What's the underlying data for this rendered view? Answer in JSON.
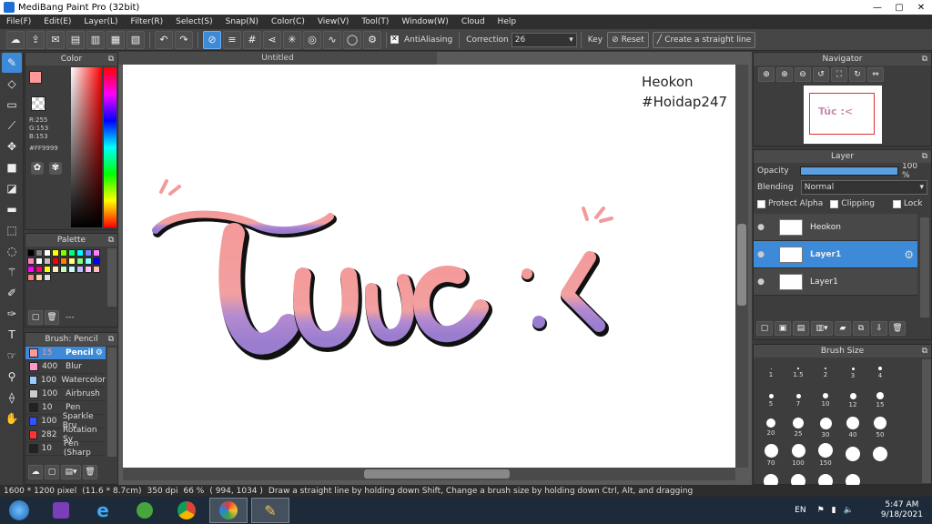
{
  "window": {
    "title": "MediBang Paint Pro (32bit)",
    "controls": [
      "—",
      "▢",
      "✕"
    ]
  },
  "menu": [
    "File(F)",
    "Edit(E)",
    "Layer(L)",
    "Filter(R)",
    "Select(S)",
    "Snap(N)",
    "Color(C)",
    "View(V)",
    "Tool(T)",
    "Window(W)",
    "Cloud",
    "Help"
  ],
  "toolbar": {
    "antialiasing_label": "AntiAliasing",
    "correction_label": "Correction",
    "correction_value": "26",
    "key_label": "Key",
    "reset_label": "Reset",
    "straight_line_label": "Create a straight line"
  },
  "color_panel": {
    "title": "Color",
    "r": "R:255",
    "g": "G:153",
    "b": "B:153",
    "hex": "#FF9999",
    "fg_color": "#ff9999",
    "bg_color": "#ff6600"
  },
  "palette_panel": {
    "title": "Palette",
    "menu_label": "---",
    "colors": [
      "#000000",
      "#808080",
      "#ffffff",
      "#ffff00",
      "#80ff00",
      "#00ff80",
      "#00ffff",
      "#8080ff",
      "#ff80ff",
      "#ff80c0",
      "#ffffff",
      "#c0c0c0",
      "#ff0000",
      "#ff8000",
      "#ffff80",
      "#80ff80",
      "#80ffff",
      "#0000ff",
      "#ff00ff",
      "#ff0080",
      "#ffff00",
      "#fff0c0",
      "#c0ffc0",
      "#c0ffff",
      "#c0c0ff",
      "#ffc0ff",
      "#ffc0c0",
      "#ff8080",
      "#ffd0a0",
      "#e0e0e0"
    ]
  },
  "brush_panel": {
    "title": "Brush: Pencil",
    "brushes": [
      {
        "size": "15",
        "name": "Pencil",
        "color": "#ff9999"
      },
      {
        "size": "400",
        "name": "Blur",
        "color": "#ff99cc"
      },
      {
        "size": "100",
        "name": "Watercolor",
        "color": "#99ccff"
      },
      {
        "size": "100",
        "name": "Airbrush",
        "color": "#cccccc"
      },
      {
        "size": "10",
        "name": "Pen",
        "color": "#222222"
      },
      {
        "size": "100",
        "name": "Sparkle Bru",
        "color": "#3355ff"
      },
      {
        "size": "282",
        "name": "Rotation Sy",
        "color": "#ff3333"
      },
      {
        "size": "10",
        "name": "Pen (Sharp",
        "color": "#222222"
      }
    ]
  },
  "document": {
    "tab": "Untitled",
    "watermark_line1": "Heokon",
    "watermark_line2": "#Hoidap247",
    "art_text": "Túc :<"
  },
  "navigator": {
    "title": "Navigator"
  },
  "layer_panel": {
    "title": "Layer",
    "opacity_label": "Opacity",
    "opacity_value": "100 %",
    "opacity": 1.0,
    "blending_label": "Blending",
    "blending_value": "Normal",
    "protect_alpha": "Protect Alpha",
    "clipping": "Clipping",
    "lock": "Lock",
    "layers": [
      {
        "name": "Heokon",
        "selected": false
      },
      {
        "name": "Layer1",
        "selected": true
      },
      {
        "name": "Layer1",
        "selected": false
      }
    ]
  },
  "brush_size_panel": {
    "title": "Brush Size",
    "sizes": [
      "1",
      "1.5",
      "2",
      "3",
      "4",
      "5",
      "7",
      "10",
      "12",
      "15",
      "20",
      "25",
      "30",
      "40",
      "50",
      "70",
      "100",
      "150",
      "",
      "",
      "",
      "",
      "",
      ""
    ]
  },
  "status": {
    "dimensions": "1600 * 1200 pixel",
    "physical": "(11.6 * 8.7cm)",
    "dpi": "350 dpi",
    "zoom": "66 %",
    "coords": "( 994, 1034 )",
    "hint": "Draw a straight line by holding down Shift, Change a brush size by holding down Ctrl, Alt, and dragging"
  },
  "taskbar": {
    "lang": "EN",
    "time": "5:47 AM",
    "date": "9/18/2021"
  }
}
